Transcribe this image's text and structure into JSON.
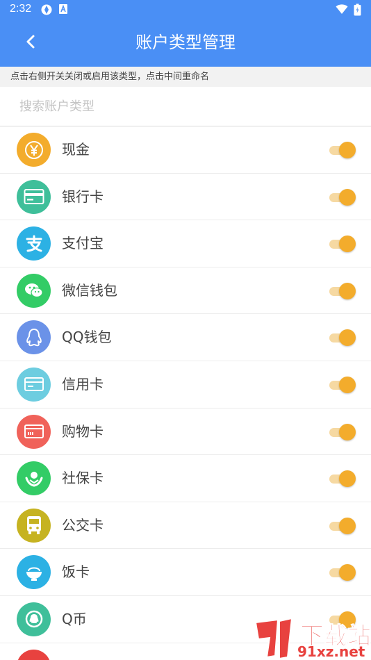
{
  "status_bar": {
    "time": "2:32",
    "left_icons": [
      "vpn-icon",
      "app-notification-icon"
    ],
    "right_icons": [
      "wifi-icon",
      "battery-icon"
    ]
  },
  "header": {
    "title": "账户类型管理",
    "back_icon": "chevron-left-icon",
    "background_color": "#4a8ff5"
  },
  "hint": "点击右侧开关关闭或启用该类型，点击中间重命名",
  "search": {
    "placeholder": "搜索账户类型",
    "value": ""
  },
  "accent_color": "#f3ac2c",
  "account_types": [
    {
      "label": "现金",
      "icon": "yen-icon",
      "color": "#f3ac2c",
      "enabled": true
    },
    {
      "label": "银行卡",
      "icon": "bank-card-icon",
      "color": "#3fbf9a",
      "enabled": true
    },
    {
      "label": "支付宝",
      "icon": "alipay-icon",
      "color": "#2cb1e4",
      "enabled": true
    },
    {
      "label": "微信钱包",
      "icon": "wechat-icon",
      "color": "#33cc66",
      "enabled": true
    },
    {
      "label": "QQ钱包",
      "icon": "qq-icon",
      "color": "#6b92e8",
      "enabled": true
    },
    {
      "label": "信用卡",
      "icon": "credit-card-icon",
      "color": "#6dcde0",
      "enabled": true
    },
    {
      "label": "购物卡",
      "icon": "shopping-card-icon",
      "color": "#f0625a",
      "enabled": true
    },
    {
      "label": "社保卡",
      "icon": "social-security-icon",
      "color": "#33cc66",
      "enabled": true
    },
    {
      "label": "公交卡",
      "icon": "bus-icon",
      "color": "#c6b321",
      "enabled": true
    },
    {
      "label": "饭卡",
      "icon": "rice-bowl-icon",
      "color": "#2cb1e4",
      "enabled": true
    },
    {
      "label": "Q币",
      "icon": "q-coin-icon",
      "color": "#3fbf9a",
      "enabled": true
    }
  ],
  "watermark": {
    "text": "下载站",
    "url": "91xz.net"
  }
}
